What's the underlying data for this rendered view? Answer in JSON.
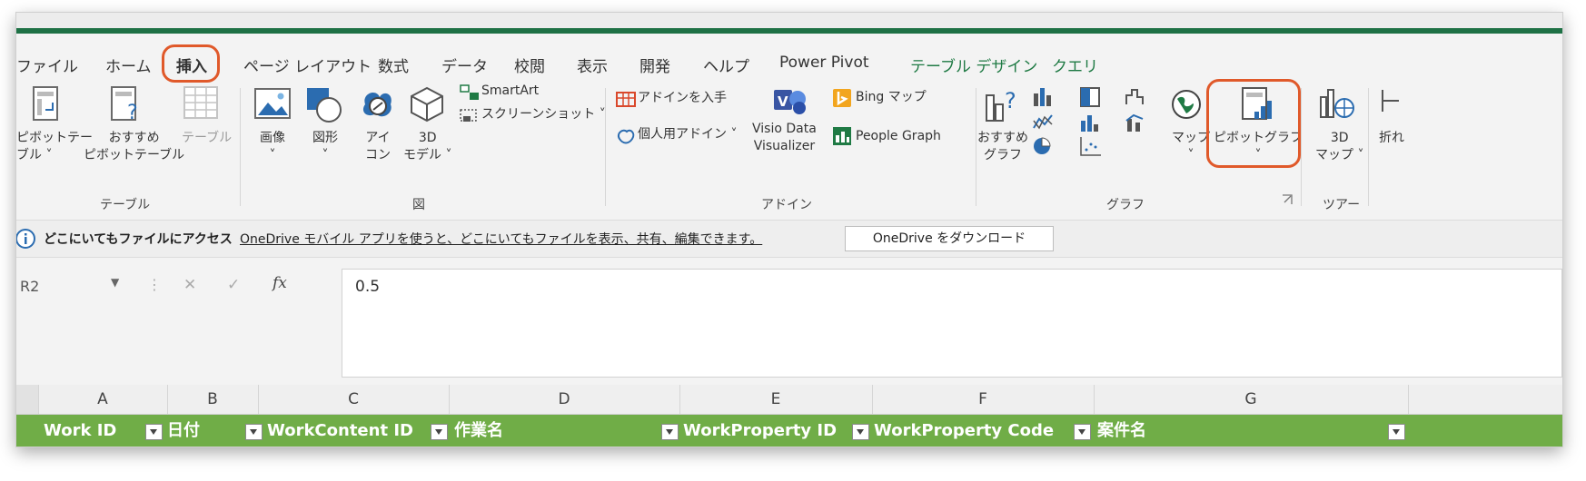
{
  "ribbon_tabs": [
    "ファイル",
    "ホーム",
    "挿入",
    "ページ レイアウト",
    "数式",
    "データ",
    "校閲",
    "表示",
    "開発",
    "ヘルプ",
    "Power Pivot",
    "テーブル デザイン",
    "クエリ"
  ],
  "groups": {
    "table": {
      "label": "テーブル",
      "pivot_table": "ピボットテー\nブル ˅",
      "recommended_pivot": "おすすめ\nピボットテーブル",
      "table": "テーブル"
    },
    "illustrations": {
      "label": "図",
      "image": "画像\n˅",
      "shapes": "図形\n˅",
      "icons": "アイ\nコン",
      "models": "3D\nモデル ˅",
      "smartart": "SmartArt",
      "screenshot": "スクリーンショット ˅"
    },
    "addins": {
      "label": "アドイン",
      "get_addins": "アドインを入手",
      "my_addins": "個人用アドイン ˅",
      "visio": "Visio Data\nVisualizer",
      "bing_map": "Bing マップ",
      "people_graph": "People Graph"
    },
    "charts": {
      "label": "グラフ",
      "recommended": "おすすめ\nグラフ",
      "map": "マップ\n˅",
      "pivot_chart": "ピボットグラフ\n˅"
    },
    "tours": {
      "label": "ツアー",
      "map3d": "3D\nマップ ˅",
      "sparkline": "折れ"
    }
  },
  "message_bar": {
    "title": "どこにいてもファイルにアクセス",
    "text": "OneDrive モバイル アプリを使うと、どこにいてもファイルを表示、共有、編集できます。",
    "button": "OneDrive をダウンロード"
  },
  "formula_bar": {
    "name_box": "R2",
    "value": "0.5",
    "cancel_glyph": "✕",
    "enter_glyph": "✓",
    "fx": "fx"
  },
  "columns": [
    "A",
    "B",
    "C",
    "D",
    "E",
    "F",
    "G"
  ],
  "table_headers": [
    "Work ID",
    "日付",
    "WorkContent ID",
    "作業名",
    "WorkProperty ID",
    "WorkProperty Code",
    "案件名"
  ],
  "colors": {
    "excel_green": "#1e7145",
    "table_header": "#70ad47",
    "highlight": "#e0592a"
  }
}
